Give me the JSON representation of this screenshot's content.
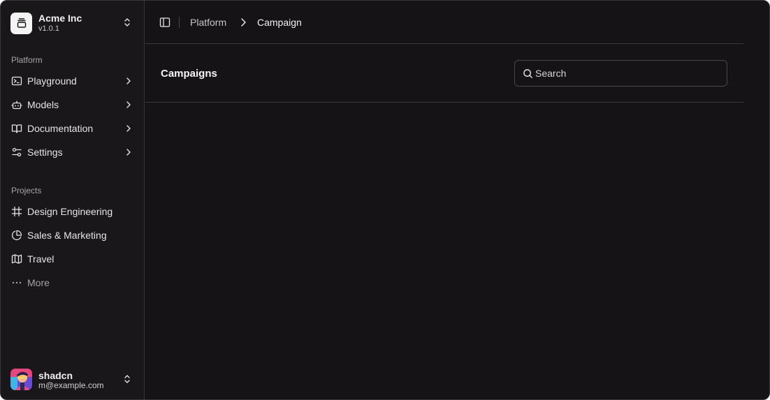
{
  "org": {
    "name": "Acme Inc",
    "version": "v1.0.1"
  },
  "sidebar": {
    "platform_label": "Platform",
    "platform_items": [
      {
        "label": "Playground",
        "icon": "terminal-icon"
      },
      {
        "label": "Models",
        "icon": "bot-icon"
      },
      {
        "label": "Documentation",
        "icon": "book-open-icon"
      },
      {
        "label": "Settings",
        "icon": "settings-sliders-icon"
      }
    ],
    "projects_label": "Projects",
    "project_items": [
      {
        "label": "Design Engineering",
        "icon": "frame-icon"
      },
      {
        "label": "Sales & Marketing",
        "icon": "pie-chart-icon"
      },
      {
        "label": "Travel",
        "icon": "map-icon"
      },
      {
        "label": "More",
        "icon": "more-horizontal-icon"
      }
    ]
  },
  "user": {
    "name": "shadcn",
    "email": "m@example.com"
  },
  "breadcrumb": {
    "parent": "Platform",
    "current": "Campaign"
  },
  "page": {
    "title": "Campaigns"
  },
  "search": {
    "placeholder": "Search",
    "value": ""
  },
  "colors": {
    "background": "#161316",
    "sidebar": "#1a171b",
    "border": "#3b383c",
    "text": "#e7e5e8"
  }
}
